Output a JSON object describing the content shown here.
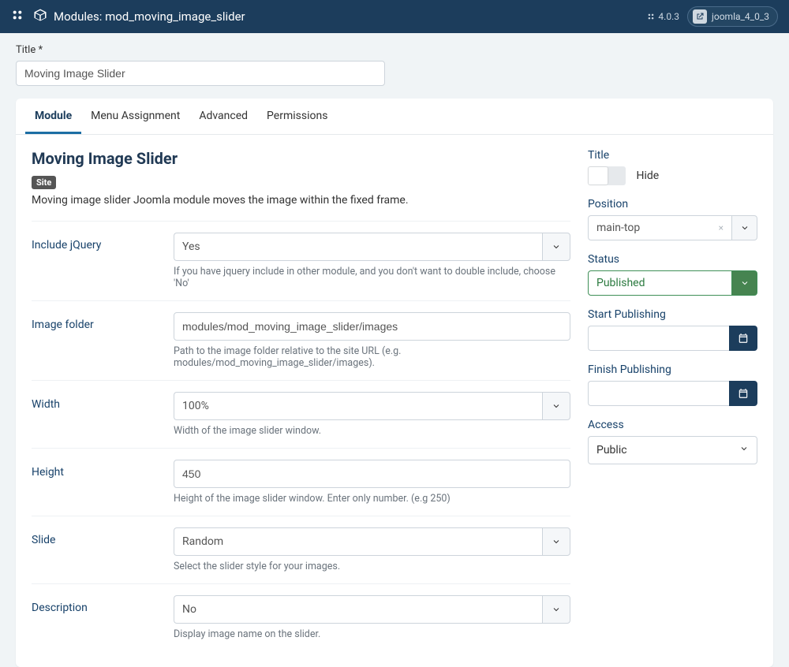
{
  "topbar": {
    "page_title": "Modules: mod_moving_image_slider",
    "version": "4.0.3",
    "site_name": "joomla_4_0_3"
  },
  "title_field": {
    "label": "Title *",
    "value": "Moving Image Slider"
  },
  "tabs": {
    "module": "Module",
    "menu_assignment": "Menu Assignment",
    "advanced": "Advanced",
    "permissions": "Permissions"
  },
  "module": {
    "heading": "Moving Image Slider",
    "site_chip": "Site",
    "description": "Moving image slider Joomla module moves the image within the fixed frame.",
    "fields": {
      "include_jquery": {
        "label": "Include jQuery",
        "value": "Yes",
        "help": "If you have jquery include in other module, and you don't want to double include, choose 'No'"
      },
      "image_folder": {
        "label": "Image folder",
        "value": "modules/mod_moving_image_slider/images",
        "help": "Path to the image folder relative to the site URL (e.g. modules/mod_moving_image_slider/images)."
      },
      "width": {
        "label": "Width",
        "value": "100%",
        "help": "Width of the image slider window."
      },
      "height": {
        "label": "Height",
        "value": "450",
        "help": "Height of the image slider window. Enter only number. (e.g 250)"
      },
      "slide": {
        "label": "Slide",
        "value": "Random",
        "help": "Select the slider style for your images."
      },
      "description_field": {
        "label": "Description",
        "value": "No",
        "help": "Display image name on the slider."
      }
    }
  },
  "sidebar": {
    "title": {
      "label": "Title",
      "switch_text": "Hide"
    },
    "position": {
      "label": "Position",
      "value": "main-top"
    },
    "status": {
      "label": "Status",
      "value": "Published"
    },
    "start_publishing": {
      "label": "Start Publishing"
    },
    "finish_publishing": {
      "label": "Finish Publishing"
    },
    "access": {
      "label": "Access",
      "value": "Public"
    }
  }
}
